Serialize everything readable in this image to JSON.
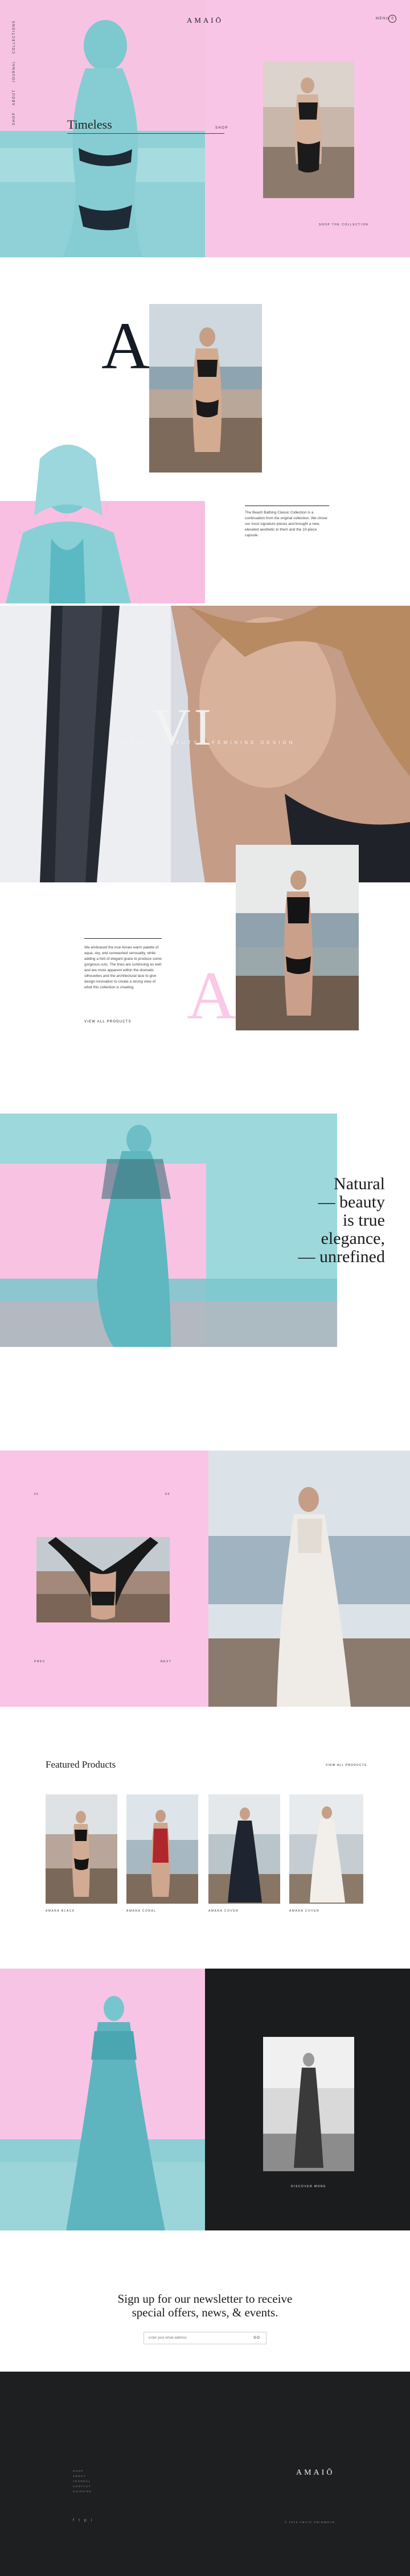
{
  "brand": {
    "logo": "AMAIŌ",
    "footer_logo": "AMAIŌ"
  },
  "header": {
    "vertical_nav": [
      "SHOP",
      "ABOUT",
      "JOURNAL",
      "COLLECTIONS"
    ],
    "menu_label": "MENU",
    "cart_count": "0"
  },
  "hero": {
    "title": "Timeless",
    "link_label": "SHOP",
    "caption": "SHOP THE COLLECTION"
  },
  "story": {
    "big_letter_a": "A",
    "paragraph": "The Beach Bathing Classic Collection is a continuation from the original collection. We chose our most signature pieces and brought a new, elevated aesthetic to them and the 10-piece capsule."
  },
  "banner": {
    "big_letters": "VI",
    "tagline": "TIMELESS BEAUTY · FEMININE DESIGN"
  },
  "embrace": {
    "paragraph": "We embraced the true Amaio warm palette of aqua, sky, and sunwashed sensuality, while adding a hint of elegant grace to produce some gorgeous cuts. The lines are continuing as well and are more apparent within the dramatic silhouettes and the architectural lace to give design innovation to create a strong view of what this collection is creating.",
    "link_label": "VIEW ALL PRODUCTS",
    "faint_letter": "A"
  },
  "quote": {
    "lines": [
      "Natural",
      "— beauty",
      "is true",
      "elegance,",
      "— unrefined"
    ]
  },
  "gallery": {
    "index_top_left": "01",
    "index_top_right": "04",
    "prev_label": "PREV",
    "next_label": "NEXT"
  },
  "featured": {
    "title": "Featured Products",
    "view_all": "VIEW ALL PRODUCTS",
    "products": [
      {
        "name": "AMARA BLACK",
        "price": "$"
      },
      {
        "name": "AMARA CORAL",
        "price": "$"
      },
      {
        "name": "AMARA COVER",
        "price": "$"
      },
      {
        "name": "AMARA COVER",
        "price": "$"
      }
    ]
  },
  "lookbook": {
    "caption": "DISCOVER MORE"
  },
  "newsletter": {
    "heading_line1": "Sign up for our newsletter to receive",
    "heading_line2": "special offers, news, & events.",
    "placeholder": "Enter your email address",
    "submit_label": "GO"
  },
  "footer": {
    "links": [
      "SHOP",
      "ABOUT",
      "JOURNAL",
      "CONTACT",
      "SHIPPING"
    ],
    "copyright": "© 2018 AMAIO SWIMWEAR",
    "socials": [
      "f",
      "t",
      "p",
      "i"
    ]
  }
}
